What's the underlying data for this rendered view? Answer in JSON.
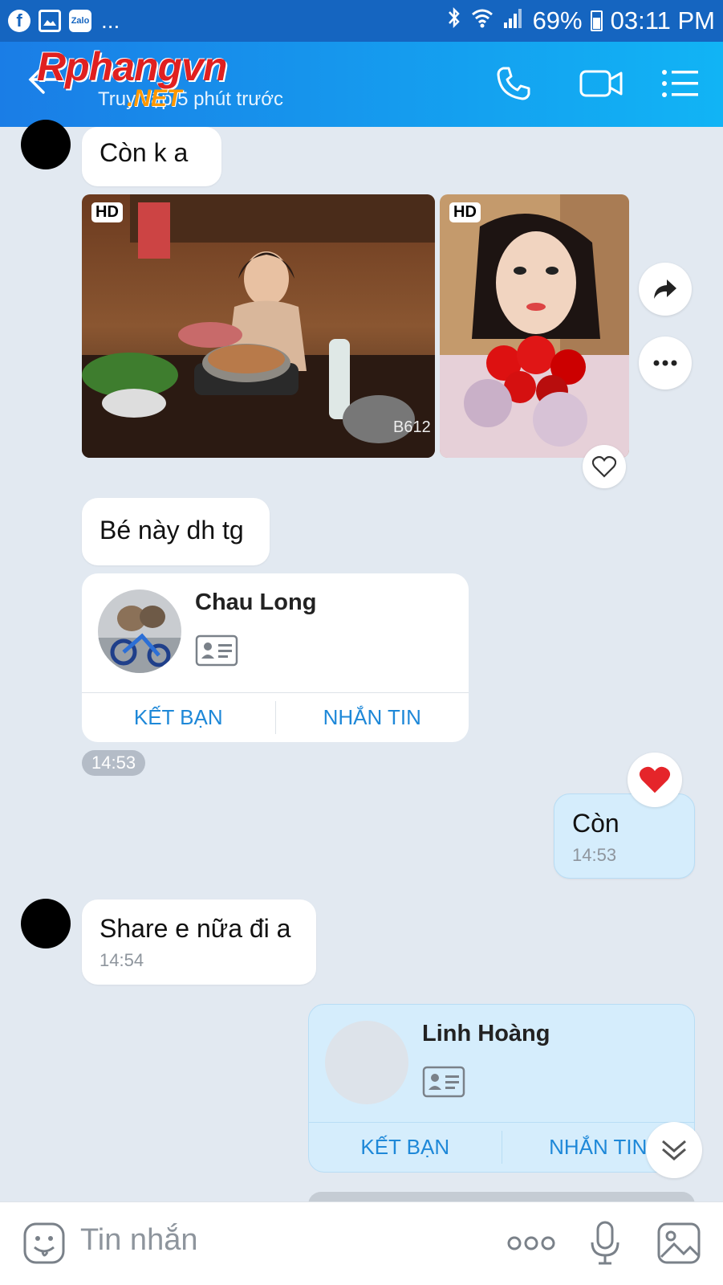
{
  "statusbar": {
    "notif_icons": [
      "facebook-icon",
      "gallery-icon",
      "zalo-icon"
    ],
    "zalo_label": "Zalo",
    "more": "...",
    "battery": "69%",
    "time": "03:11 PM"
  },
  "header": {
    "watermark_main": "Rphangvn",
    "watermark_sub": ".NET",
    "status": "Truy cập 5 phút trước",
    "icons": [
      "back-arrow-icon",
      "phone-icon",
      "video-icon",
      "menu-icon"
    ]
  },
  "messages": {
    "m1": {
      "text": "Còn k a"
    },
    "photos": {
      "hd_left": "HD",
      "hd_right": "HD",
      "stamp": "B612"
    },
    "m2": {
      "text": "Bé này dh tg"
    },
    "card1": {
      "name": "Chau Long",
      "add_friend": "KẾT BẠN",
      "message": "NHẮN TIN"
    },
    "time_pill": "14:53",
    "m3": {
      "text": "Còn",
      "time": "14:53"
    },
    "m4": {
      "text": "Share e nữa đi a",
      "time": "14:54"
    },
    "card2": {
      "name": "Linh Hoàng",
      "add_friend": "KẾT BẠN",
      "message": "NHẮN TIN"
    }
  },
  "inputbar": {
    "placeholder": "Tin nhắn"
  },
  "colors": {
    "header_start": "#1a7de6",
    "header_end": "#11b4f5",
    "chat_bg": "#e2e9f1",
    "my_bubble": "#d5edfc",
    "accent_link": "#1e88d8"
  }
}
